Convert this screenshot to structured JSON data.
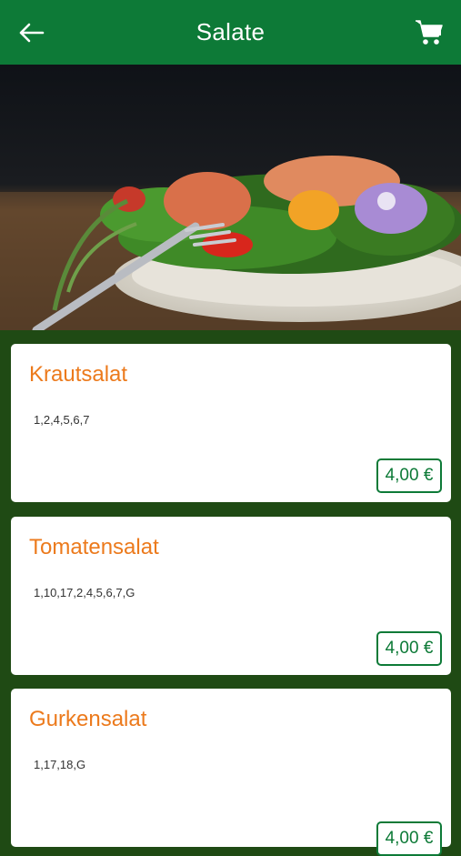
{
  "header": {
    "title": "Salate"
  },
  "icons": {
    "back": "arrow-left-icon",
    "cart": "shopping-cart-icon"
  },
  "colors": {
    "header": "#0d7a37",
    "background": "#1f4a14",
    "item_title": "#ec7a1c",
    "price": "#0d7a37"
  },
  "items": [
    {
      "name": "Krautsalat",
      "codes": "1,2,4,5,6,7",
      "price": "4,00 €"
    },
    {
      "name": "Tomatensalat",
      "codes": "1,10,17,2,4,5,6,7,G",
      "price": "4,00 €"
    },
    {
      "name": "Gurkensalat",
      "codes": "1,17,18,G",
      "price": "4,00 €"
    }
  ]
}
